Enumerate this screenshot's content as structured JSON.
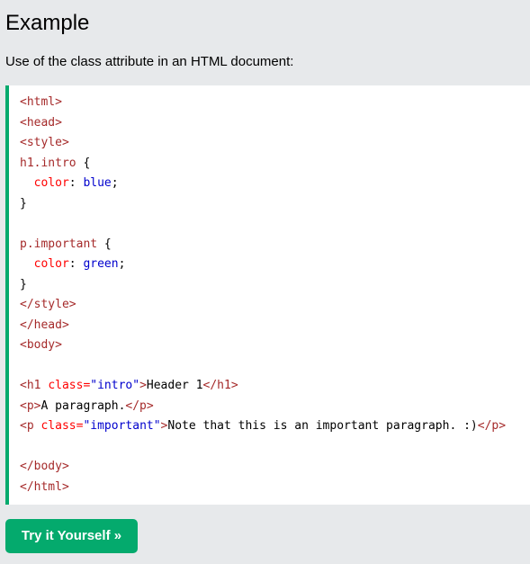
{
  "heading": "Example",
  "description": "Use of the class attribute in an HTML document:",
  "code_lines": [
    [
      {
        "c": "tag",
        "t": "<html>"
      }
    ],
    [
      {
        "c": "tag",
        "t": "<head>"
      }
    ],
    [
      {
        "c": "tag",
        "t": "<style>"
      }
    ],
    [
      {
        "c": "sel",
        "t": "h1.intro"
      },
      {
        "c": "txt",
        "t": " {"
      }
    ],
    [
      {
        "c": "txt",
        "t": "  "
      },
      {
        "c": "prop",
        "t": "color"
      },
      {
        "c": "txt",
        "t": ": "
      },
      {
        "c": "pval",
        "t": "blue"
      },
      {
        "c": "txt",
        "t": ";"
      }
    ],
    [
      {
        "c": "txt",
        "t": "}"
      }
    ],
    [
      {
        "c": "txt",
        "t": " "
      }
    ],
    [
      {
        "c": "sel",
        "t": "p.important"
      },
      {
        "c": "txt",
        "t": " {"
      }
    ],
    [
      {
        "c": "txt",
        "t": "  "
      },
      {
        "c": "prop",
        "t": "color"
      },
      {
        "c": "txt",
        "t": ": "
      },
      {
        "c": "pval",
        "t": "green"
      },
      {
        "c": "txt",
        "t": ";"
      }
    ],
    [
      {
        "c": "txt",
        "t": "}"
      }
    ],
    [
      {
        "c": "tag",
        "t": "</style>"
      }
    ],
    [
      {
        "c": "tag",
        "t": "</head>"
      }
    ],
    [
      {
        "c": "tag",
        "t": "<body>"
      }
    ],
    [
      {
        "c": "txt",
        "t": " "
      }
    ],
    [
      {
        "c": "tag",
        "t": "<h1 "
      },
      {
        "c": "attr",
        "t": "class="
      },
      {
        "c": "aval",
        "t": "\"intro\""
      },
      {
        "c": "tag",
        "t": ">"
      },
      {
        "c": "txt",
        "t": "Header 1"
      },
      {
        "c": "tag",
        "t": "</h1>"
      }
    ],
    [
      {
        "c": "tag",
        "t": "<p>"
      },
      {
        "c": "txt",
        "t": "A paragraph."
      },
      {
        "c": "tag",
        "t": "</p>"
      }
    ],
    [
      {
        "c": "tag",
        "t": "<p "
      },
      {
        "c": "attr",
        "t": "class="
      },
      {
        "c": "aval",
        "t": "\"important\""
      },
      {
        "c": "tag",
        "t": ">"
      },
      {
        "c": "txt",
        "t": "Note that this is an important paragraph. :)"
      },
      {
        "c": "tag",
        "t": "</p>"
      }
    ],
    [
      {
        "c": "txt",
        "t": " "
      }
    ],
    [
      {
        "c": "tag",
        "t": "</body>"
      }
    ],
    [
      {
        "c": "tag",
        "t": "</html>"
      }
    ]
  ],
  "try_button_label": "Try it Yourself »",
  "colors": {
    "accent": "#04aa6d",
    "background": "#e7e9eb",
    "tag": "#a52a2a",
    "attribute": "#ff0000",
    "value": "#0000cd"
  }
}
